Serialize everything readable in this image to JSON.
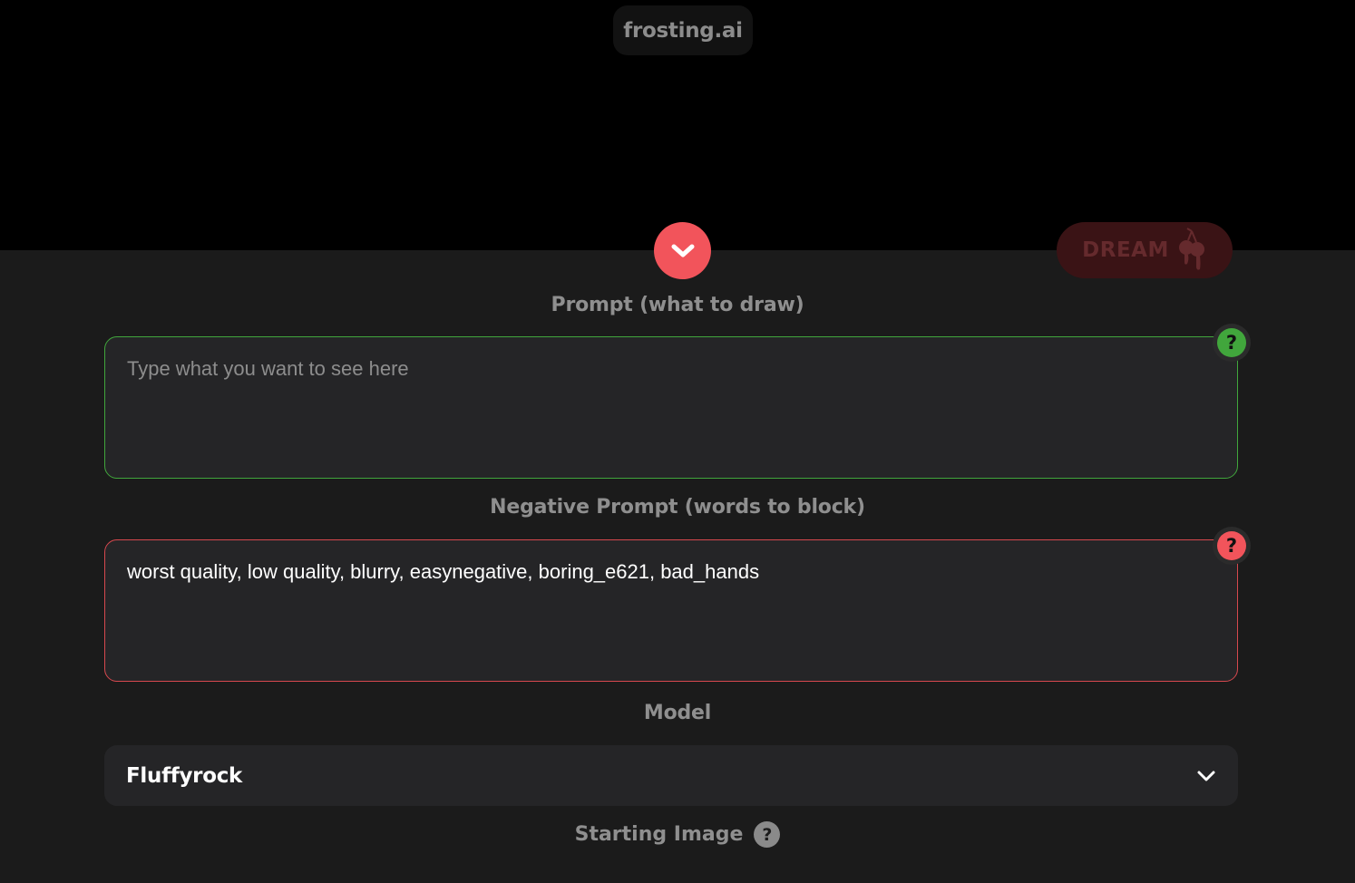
{
  "brand": {
    "name": "frosting.ai"
  },
  "actions": {
    "dream_label": "DREAM"
  },
  "prompt": {
    "label": "Prompt (what to draw)",
    "placeholder": "Type what you want to see here",
    "value": "",
    "help_symbol": "?",
    "accent_color": "#41a63c"
  },
  "negative_prompt": {
    "label": "Negative Prompt (words to block)",
    "value": "worst quality, low quality, blurry, easynegative, boring_e621, bad_hands",
    "help_symbol": "?",
    "accent_color": "#d6484e"
  },
  "model": {
    "label": "Model",
    "selected": "Fluffyrock"
  },
  "starting_image": {
    "label": "Starting Image",
    "help_symbol": "?"
  },
  "colors": {
    "brand_red": "#f2545b",
    "background_top": "#000000",
    "background_panel": "#1b1b1b"
  }
}
